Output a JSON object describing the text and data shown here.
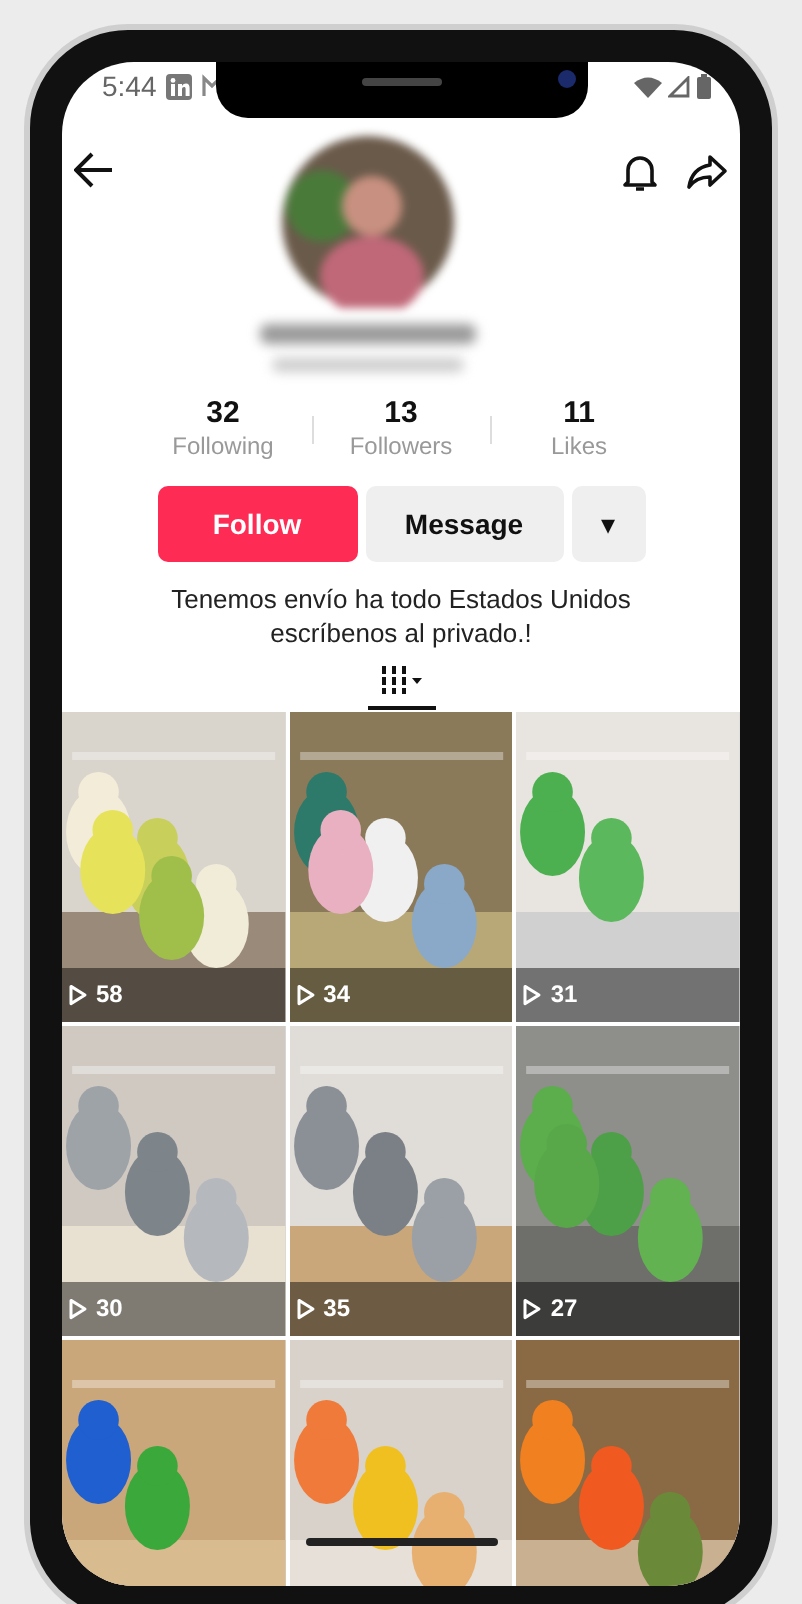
{
  "status_bar": {
    "time": "5:44"
  },
  "stats": [
    {
      "value": "32",
      "label": "Following"
    },
    {
      "value": "13",
      "label": "Followers"
    },
    {
      "value": "11",
      "label": "Likes"
    }
  ],
  "actions": {
    "follow": "Follow",
    "message": "Message",
    "more": "▾"
  },
  "bio": "Tenemos envío ha todo Estados Unidos escríbenos al privado.!",
  "tabs": [
    {
      "kind": "grid",
      "selected": true
    }
  ],
  "videos": [
    {
      "kind": "picture",
      "views": "58"
    },
    {
      "kind": "picture",
      "views": "34"
    },
    {
      "kind": "picture",
      "views": "31"
    },
    {
      "kind": "picture",
      "views": "30"
    },
    {
      "kind": "picture",
      "views": "35"
    },
    {
      "kind": "picture",
      "views": "27"
    },
    {
      "kind": "picture"
    },
    {
      "kind": "picture"
    },
    {
      "kind": "picture"
    }
  ]
}
